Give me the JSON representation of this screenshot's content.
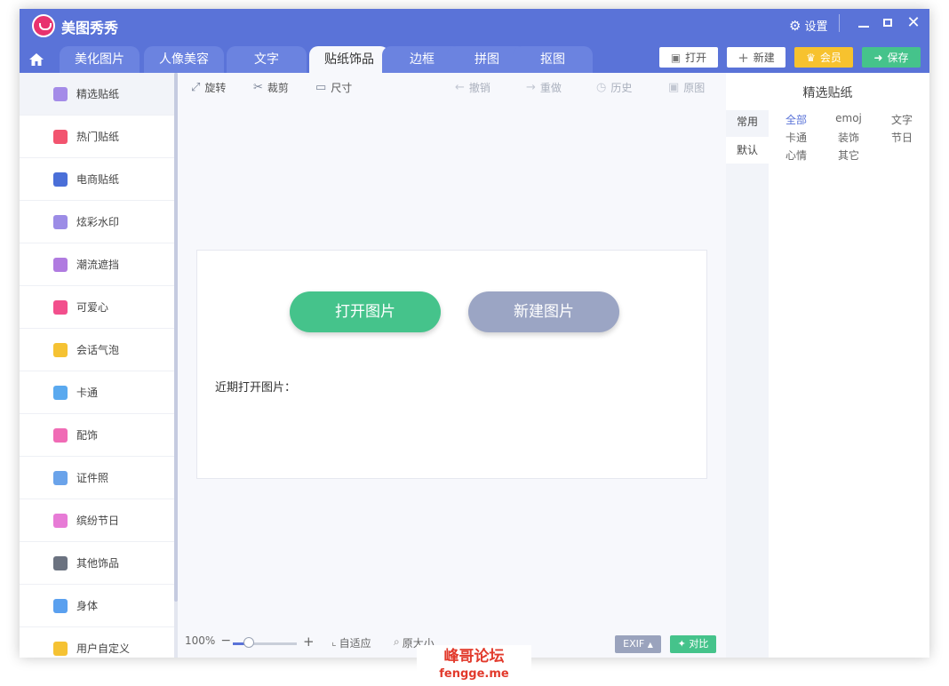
{
  "app": {
    "title": "美图秀秀",
    "settings_label": "设置"
  },
  "tabs": [
    "美化图片",
    "人像美容",
    "文字",
    "贴纸饰品",
    "边框",
    "拼图",
    "抠图"
  ],
  "active_tab": "贴纸饰品",
  "header_buttons": {
    "open": "打开",
    "new": "新建",
    "vip": "会员",
    "save": "保存"
  },
  "sidebar": {
    "items": [
      {
        "label": "精选贴纸",
        "icon": "sticker-icon",
        "color": "#a48be8"
      },
      {
        "label": "热门贴纸",
        "icon": "flame-icon",
        "color": "#f2546f"
      },
      {
        "label": "电商贴纸",
        "icon": "cart-icon",
        "color": "#4a6fd8"
      },
      {
        "label": "炫彩水印",
        "icon": "watermark-icon",
        "color": "#9c8ce6"
      },
      {
        "label": "潮流遮挡",
        "icon": "mask-icon",
        "color": "#b07be0"
      },
      {
        "label": "可爱心",
        "icon": "heart-icon",
        "color": "#f24f8c"
      },
      {
        "label": "会话气泡",
        "icon": "chat-bubble-icon",
        "color": "#f5c233"
      },
      {
        "label": "卡通",
        "icon": "cartoon-icon",
        "color": "#5aa9ef"
      },
      {
        "label": "配饰",
        "icon": "bow-icon",
        "color": "#f06bb5"
      },
      {
        "label": "证件照",
        "icon": "id-photo-icon",
        "color": "#6aa3ea"
      },
      {
        "label": "缤纷节日",
        "icon": "balloon-icon",
        "color": "#e77bd6"
      },
      {
        "label": "其他饰品",
        "icon": "grid-icon",
        "color": "#6b7280"
      },
      {
        "label": "身体",
        "icon": "person-icon",
        "color": "#5aa0ef"
      },
      {
        "label": "用户自定义",
        "icon": "pencil-icon",
        "color": "#f5c233"
      }
    ]
  },
  "toolbar": {
    "rotate": "旋转",
    "crop": "裁剪",
    "size": "尺寸",
    "undo": "撤销",
    "redo": "重做",
    "history": "历史",
    "original": "原图"
  },
  "main": {
    "open_image": "打开图片",
    "new_image": "新建图片",
    "recent_label": "近期打开图片："
  },
  "bottom": {
    "zoom": "100%",
    "fit": "自适应",
    "actual_size": "原大小",
    "exif": "EXIF",
    "compare": "对比"
  },
  "right_panel": {
    "title": "精选贴纸",
    "tabs": [
      "常用",
      "默认"
    ],
    "categories": [
      "全部",
      "emoj",
      "文字",
      "卡通",
      "装饰",
      "节日",
      "心情",
      "其它"
    ]
  },
  "watermark": {
    "line1": "峰哥论坛",
    "line2": "fengge.me"
  },
  "colors": {
    "accent": "#5a73d8",
    "green": "#45c38b",
    "gray_button": "#9ba5c4",
    "gold": "#f7c22e"
  }
}
